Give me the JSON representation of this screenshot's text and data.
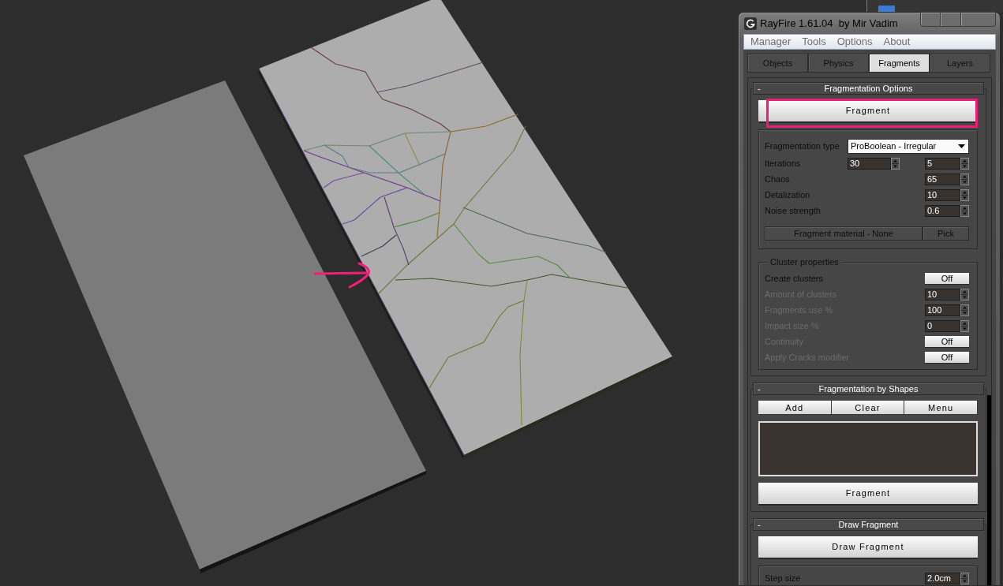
{
  "window": {
    "title": "RayFire 1.61.04  by Mir Vadim"
  },
  "menu": [
    "Manager",
    "Tools",
    "Options",
    "About"
  ],
  "tabs": [
    {
      "label": "Objects",
      "selected": false
    },
    {
      "label": "Physics",
      "selected": false
    },
    {
      "label": "Fragments",
      "selected": true
    },
    {
      "label": "Layers",
      "selected": false
    }
  ],
  "rollouts": [
    {
      "title": "Fragmentation Options",
      "collapse_sign": "-",
      "items": [
        {
          "kind": "button",
          "label": "Fragment",
          "highlighted": true
        },
        {
          "kind": "group",
          "rows": [
            {
              "kind": "dropdown",
              "label": "Fragmentation type",
              "value": "ProBoolean - Irregular",
              "disabled": false
            },
            {
              "kind": "spinner_pair",
              "label": "Iterations",
              "values": [
                "30",
                "5"
              ],
              "disabled": false
            },
            {
              "kind": "spinner",
              "label": "Chaos",
              "value": "65",
              "disabled": false
            },
            {
              "kind": "spinner",
              "label": "Detalization",
              "value": "10",
              "disabled": false
            },
            {
              "kind": "spinner",
              "label": "Noise strength",
              "value": "0.6",
              "disabled": false
            }
          ],
          "footer_buttons": [
            "Fragment material - None",
            "Pick"
          ]
        },
        {
          "kind": "group",
          "title": "Cluster properties",
          "rows": [
            {
              "kind": "toggle",
              "label": "Create clusters",
              "value": "Off",
              "disabled": false
            },
            {
              "kind": "spinner",
              "label": "Amount of clusters",
              "value": "10",
              "disabled": true
            },
            {
              "kind": "spinner",
              "label": "Fragments use %",
              "value": "100",
              "disabled": true
            },
            {
              "kind": "spinner",
              "label": "Impact size %",
              "value": "0",
              "disabled": true
            },
            {
              "kind": "toggle",
              "label": "Continuity",
              "value": "Off",
              "disabled": true
            },
            {
              "kind": "toggle",
              "label": "Apply Cracks modifier",
              "value": "Off",
              "disabled": true
            }
          ]
        }
      ]
    },
    {
      "title": "Fragmentation by Shapes",
      "collapse_sign": "-",
      "items": [
        {
          "kind": "button_row",
          "labels": [
            "Add",
            "Clear",
            "Menu"
          ]
        },
        {
          "kind": "list_box"
        },
        {
          "kind": "button",
          "label": "Fragment",
          "highlighted": false
        }
      ]
    },
    {
      "title": "Draw Fragment",
      "collapse_sign": "-",
      "items": [
        {
          "kind": "button",
          "label": "Draw Fragment",
          "highlighted": false
        },
        {
          "kind": "group",
          "rows": [
            {
              "kind": "spinner",
              "label": "Step size",
              "value": "2.0cm",
              "disabled": false
            }
          ]
        }
      ]
    }
  ]
}
